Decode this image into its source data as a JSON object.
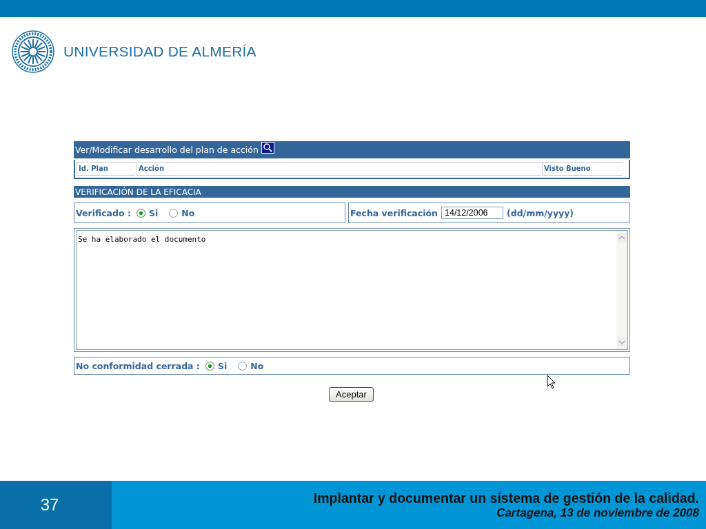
{
  "logo": {
    "name": "UNIVERSIDAD DE ALMERÍA"
  },
  "plan_panel": {
    "title": "Ver/Modificar desarrollo del plan de acción",
    "columns": [
      "Id. Plan",
      "Acción",
      "Visto Bueno"
    ]
  },
  "section": {
    "title": "VERIFICACIÓN DE LA EFICACIA"
  },
  "verificado": {
    "label": "Verificado :",
    "options": [
      {
        "label": "Si",
        "selected": true
      },
      {
        "label": "No",
        "selected": false
      }
    ]
  },
  "fecha": {
    "label": "Fecha verificación",
    "value": "14/12/2006",
    "hint": "(dd/mm/yyyy)"
  },
  "notes": {
    "value": "Se ha elaborado el documento"
  },
  "cerrada": {
    "label": "No conformidad cerrada :",
    "options": [
      {
        "label": "Si",
        "selected": true
      },
      {
        "label": "No",
        "selected": false
      }
    ]
  },
  "buttons": [
    "Aceptar"
  ],
  "footer": {
    "page_number": "37",
    "title": "Implantar y documentar un sistema de gestión de la calidad.",
    "subtitle": "Cartagena, 13 de noviembre de 2008"
  }
}
